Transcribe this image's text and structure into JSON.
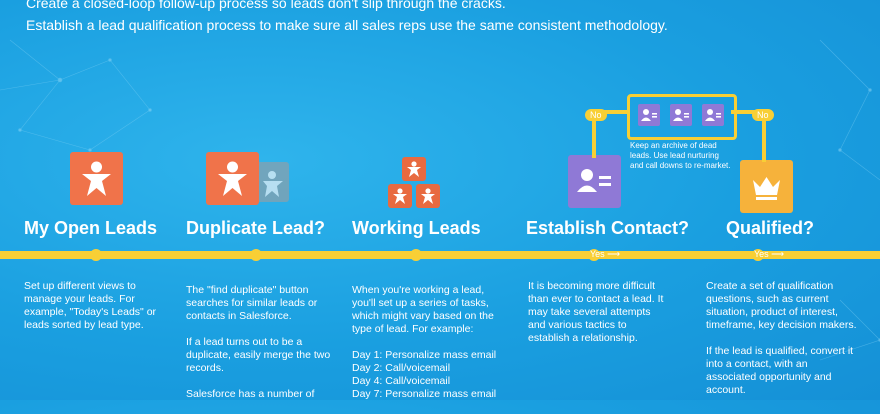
{
  "intro": {
    "line1": "Create a closed-loop follow-up process so leads don't slip through the cracks.",
    "line2": "Establish a lead qualification process to make sure all sales reps use the same consistent methodology."
  },
  "stages": [
    {
      "title": "My Open Leads",
      "icon": "person-icon"
    },
    {
      "title": "Duplicate Lead?",
      "icon": "duplicate-person-icon"
    },
    {
      "title": "Working Leads",
      "icon": "stacked-people-icon"
    },
    {
      "title": "Establish Contact?",
      "icon": "contact-card-icon"
    },
    {
      "title": "Qualified?",
      "icon": "crown-icon"
    }
  ],
  "yes_label": "Yes ⟶",
  "no_label": "No",
  "archive": {
    "lines": [
      "Keep an archive of dead",
      "leads. Use lead nurturing",
      "and call downs to re-market."
    ]
  },
  "columns": {
    "open_leads": [
      "Set up different views to",
      "manage your leads. For",
      "example, \"Today's Leads\" or",
      "leads sorted by lead type."
    ],
    "duplicate_p1": [
      "The \"find duplicate\" button",
      "searches for similar leads or",
      "contacts in Salesforce."
    ],
    "duplicate_p2": [
      "If a lead turns out to be a",
      "duplicate, easily merge the two",
      "records."
    ],
    "duplicate_p3": [
      "Salesforce has a number of"
    ],
    "working_p1": [
      "When you're working a lead,",
      "you'll set up a series of tasks,",
      "which might vary based on the",
      "type of lead. For example:"
    ],
    "working_p2": [
      "Day 1: Personalize mass email",
      "Day 2: Call/voicemail",
      "Day 4: Call/voicemail",
      "Day 7: Personalize mass email"
    ],
    "contact_p1": [
      "It is becoming more difficult",
      "than ever to contact a lead. It",
      "may take several attempts",
      "and various tactics to",
      "establish a relationship."
    ],
    "qualified_p1": [
      "Create a set of qualification",
      "questions, such as current",
      "situation, product of interest,",
      "timeframe, key decision makers."
    ],
    "qualified_p2": [
      "If the lead is qualified, convert it",
      "into a contact, with an",
      "associated opportunity and",
      "account."
    ]
  },
  "colors": {
    "background": "#1a9fe0",
    "timeline": "#f8cf35",
    "orange": "#f0734a",
    "purple": "#8f79d6",
    "gold": "#f6b23b"
  }
}
